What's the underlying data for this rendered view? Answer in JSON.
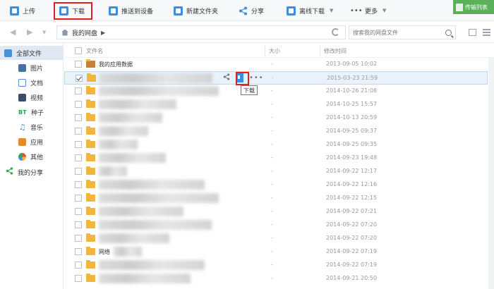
{
  "toolbar": {
    "upload": "上传",
    "download": "下载",
    "push_device": "推送到设备",
    "new_folder": "新建文件夹",
    "share": "分享",
    "offline_download": "离线下载",
    "more": "更多",
    "transfer_list": "传输列表"
  },
  "address": {
    "path_root": "我的网盘",
    "search_placeholder": "搜索我的网盘文件"
  },
  "sidebar": {
    "items": [
      {
        "label": "全部文件",
        "icon": "computer-icon",
        "color": "#4a90d9"
      },
      {
        "label": "图片",
        "icon": "image-icon",
        "color": "#4a6fa5"
      },
      {
        "label": "文档",
        "icon": "document-icon",
        "color": "#5a8fd0"
      },
      {
        "label": "视频",
        "icon": "video-icon",
        "color": "#3c4e66"
      },
      {
        "label": "种子",
        "icon": "bt-icon",
        "color": "#2aa64a"
      },
      {
        "label": "音乐",
        "icon": "music-icon",
        "color": "#3b8ee0"
      },
      {
        "label": "应用",
        "icon": "app-icon",
        "color": "#e58a2a"
      },
      {
        "label": "其他",
        "icon": "other-icon",
        "color": "#e0553a"
      }
    ],
    "share": {
      "label": "我的分享",
      "icon": "share-icon"
    }
  },
  "table": {
    "headers": {
      "name": "文件名",
      "size": "大小",
      "modified": "修改时间"
    },
    "rows": [
      {
        "name": "我的应用数据",
        "size": "-",
        "date": "2013-09-05 10:02",
        "app": true
      },
      {
        "name": "",
        "size": "-",
        "date": "2015-03-23 21:59",
        "selected": true
      },
      {
        "name": "",
        "size": "-",
        "date": "2014-10-26 21:08"
      },
      {
        "name": "",
        "size": "-",
        "date": "2014-10-25 15:57"
      },
      {
        "name": "",
        "size": "-",
        "date": "2014-10-13 20:59"
      },
      {
        "name": "",
        "size": "-",
        "date": "2014-09-25 09:37"
      },
      {
        "name": "",
        "size": "-",
        "date": "2014-09-25 09:35"
      },
      {
        "name": "",
        "size": "-",
        "date": "2014-09-23 19:48"
      },
      {
        "name": "",
        "size": "-",
        "date": "2014-09-22 12:17"
      },
      {
        "name": "",
        "size": "-",
        "date": "2014-09-22 12:16"
      },
      {
        "name": "",
        "size": "-",
        "date": "2014-09-22 12:15"
      },
      {
        "name": "",
        "size": "-",
        "date": "2014-09-22 07:21"
      },
      {
        "name": "",
        "size": "-",
        "date": "2014-09-22 07:20"
      },
      {
        "name": "",
        "size": "-",
        "date": "2014-09-22 07:20"
      },
      {
        "name": "网络",
        "size": "-",
        "date": "2014-09-22 07:19"
      },
      {
        "name": "",
        "size": "-",
        "date": "2014-09-22 07:19"
      },
      {
        "name": "",
        "size": "-",
        "date": "2014-09-21 20:50"
      }
    ]
  },
  "tooltip": "下载",
  "colors": {
    "accent": "#3b8ee0",
    "highlight": "#e0201e",
    "transfer_green": "#5bb05a",
    "selection": "#e8f2fc"
  }
}
